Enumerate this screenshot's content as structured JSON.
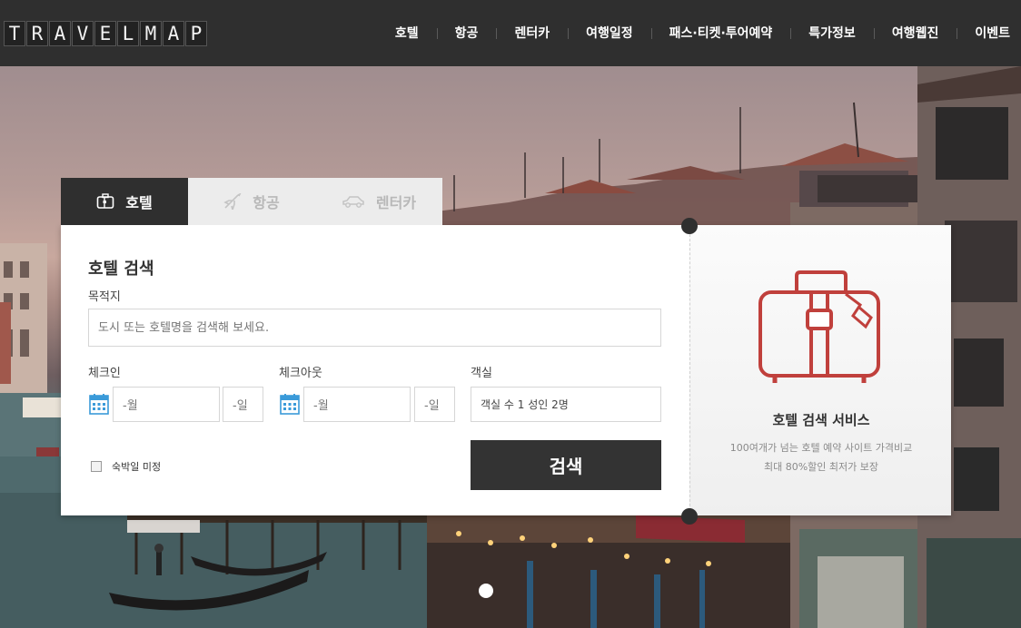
{
  "logo": {
    "letters": [
      "T",
      "R",
      "A",
      "V",
      "E",
      "L",
      "M",
      "A",
      "P"
    ]
  },
  "nav": {
    "items": [
      "호텔",
      "항공",
      "렌터카",
      "여행일정",
      "패스·티켓·투어예약",
      "특가정보",
      "여행웹진",
      "이벤트"
    ]
  },
  "tabs": [
    {
      "label": "호텔",
      "icon": "hotel-luggage-icon",
      "active": true
    },
    {
      "label": "항공",
      "icon": "airplane-icon",
      "active": false
    },
    {
      "label": "렌터카",
      "icon": "car-icon",
      "active": false
    }
  ],
  "search": {
    "title": "호텔 검색",
    "destination_label": "목적지",
    "destination_placeholder": "도시 또는 호텔명을 검색해 보세요.",
    "checkin_label": "체크인",
    "checkout_label": "체크아웃",
    "rooms_label": "객실",
    "checkin_month": "-월",
    "checkin_day": "-일",
    "checkout_month": "-월",
    "checkout_day": "-일",
    "rooms_value": "객실 수 1 성인 2명",
    "undecided_label": "숙박일 미정",
    "undecided_checked": false,
    "button_label": "검색"
  },
  "service": {
    "title": "호텔 검색 서비스",
    "line1": "100여개가 넘는 호텔 예약 사이트 가격비교",
    "line2": "최대 80%할인 최저가 보장"
  },
  "colors": {
    "header_bg": "#2f2f2f",
    "accent_red": "#c0403c",
    "calendar_blue": "#3a9ad9",
    "button_bg": "#333333"
  },
  "slider": {
    "active_index": 0,
    "count": 1
  }
}
